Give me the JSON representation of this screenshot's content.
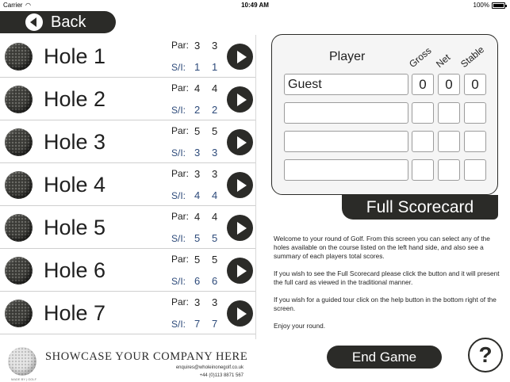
{
  "status_bar": {
    "carrier": "Carrier",
    "time": "10:49 AM",
    "battery": "100%"
  },
  "back_button": {
    "label": "Back"
  },
  "holes": [
    {
      "name": "Hole 1",
      "par": [
        "3",
        "3"
      ],
      "si": [
        "1",
        "1"
      ]
    },
    {
      "name": "Hole 2",
      "par": [
        "4",
        "4"
      ],
      "si": [
        "2",
        "2"
      ]
    },
    {
      "name": "Hole 3",
      "par": [
        "5",
        "5"
      ],
      "si": [
        "3",
        "3"
      ]
    },
    {
      "name": "Hole 4",
      "par": [
        "3",
        "3"
      ],
      "si": [
        "4",
        "4"
      ]
    },
    {
      "name": "Hole 5",
      "par": [
        "4",
        "4"
      ],
      "si": [
        "5",
        "5"
      ]
    },
    {
      "name": "Hole 6",
      "par": [
        "5",
        "5"
      ],
      "si": [
        "6",
        "6"
      ]
    },
    {
      "name": "Hole 7",
      "par": [
        "3",
        "3"
      ],
      "si": [
        "7",
        "7"
      ]
    }
  ],
  "labels": {
    "par": "Par:",
    "si": "S/I:"
  },
  "sponsor": {
    "title": "SHOWCASE YOUR COMPANY HERE",
    "email": "enquires@wholeinonegolf.co.uk",
    "phone": "+44 (0)113 8871 567",
    "small_text": "MADE BY | GOLF"
  },
  "scorecard": {
    "player_header": "Player",
    "col_gross": "Gross",
    "col_net": "Net",
    "col_stable": "Stable",
    "rows": [
      {
        "name": "Guest",
        "gross": "0",
        "net": "0",
        "stable": "0"
      },
      {
        "name": "",
        "gross": "",
        "net": "",
        "stable": ""
      },
      {
        "name": "",
        "gross": "",
        "net": "",
        "stable": ""
      },
      {
        "name": "",
        "gross": "",
        "net": "",
        "stable": ""
      }
    ],
    "full_button": "Full Scorecard"
  },
  "instructions": [
    "Welcome to your round of Golf. From this screen you can select any of the holes available on the course listed on the left hand side, and also see a summary of each players total scores.",
    "If you wish to see the Full Scorecard please click the button and it will present the full card as viewed in the traditional manner.",
    "If you wish for a guided tour click on the help button in the bottom right of the screen.",
    "Enjoy your round."
  ],
  "end_game_button": "End Game",
  "help_button": "?"
}
